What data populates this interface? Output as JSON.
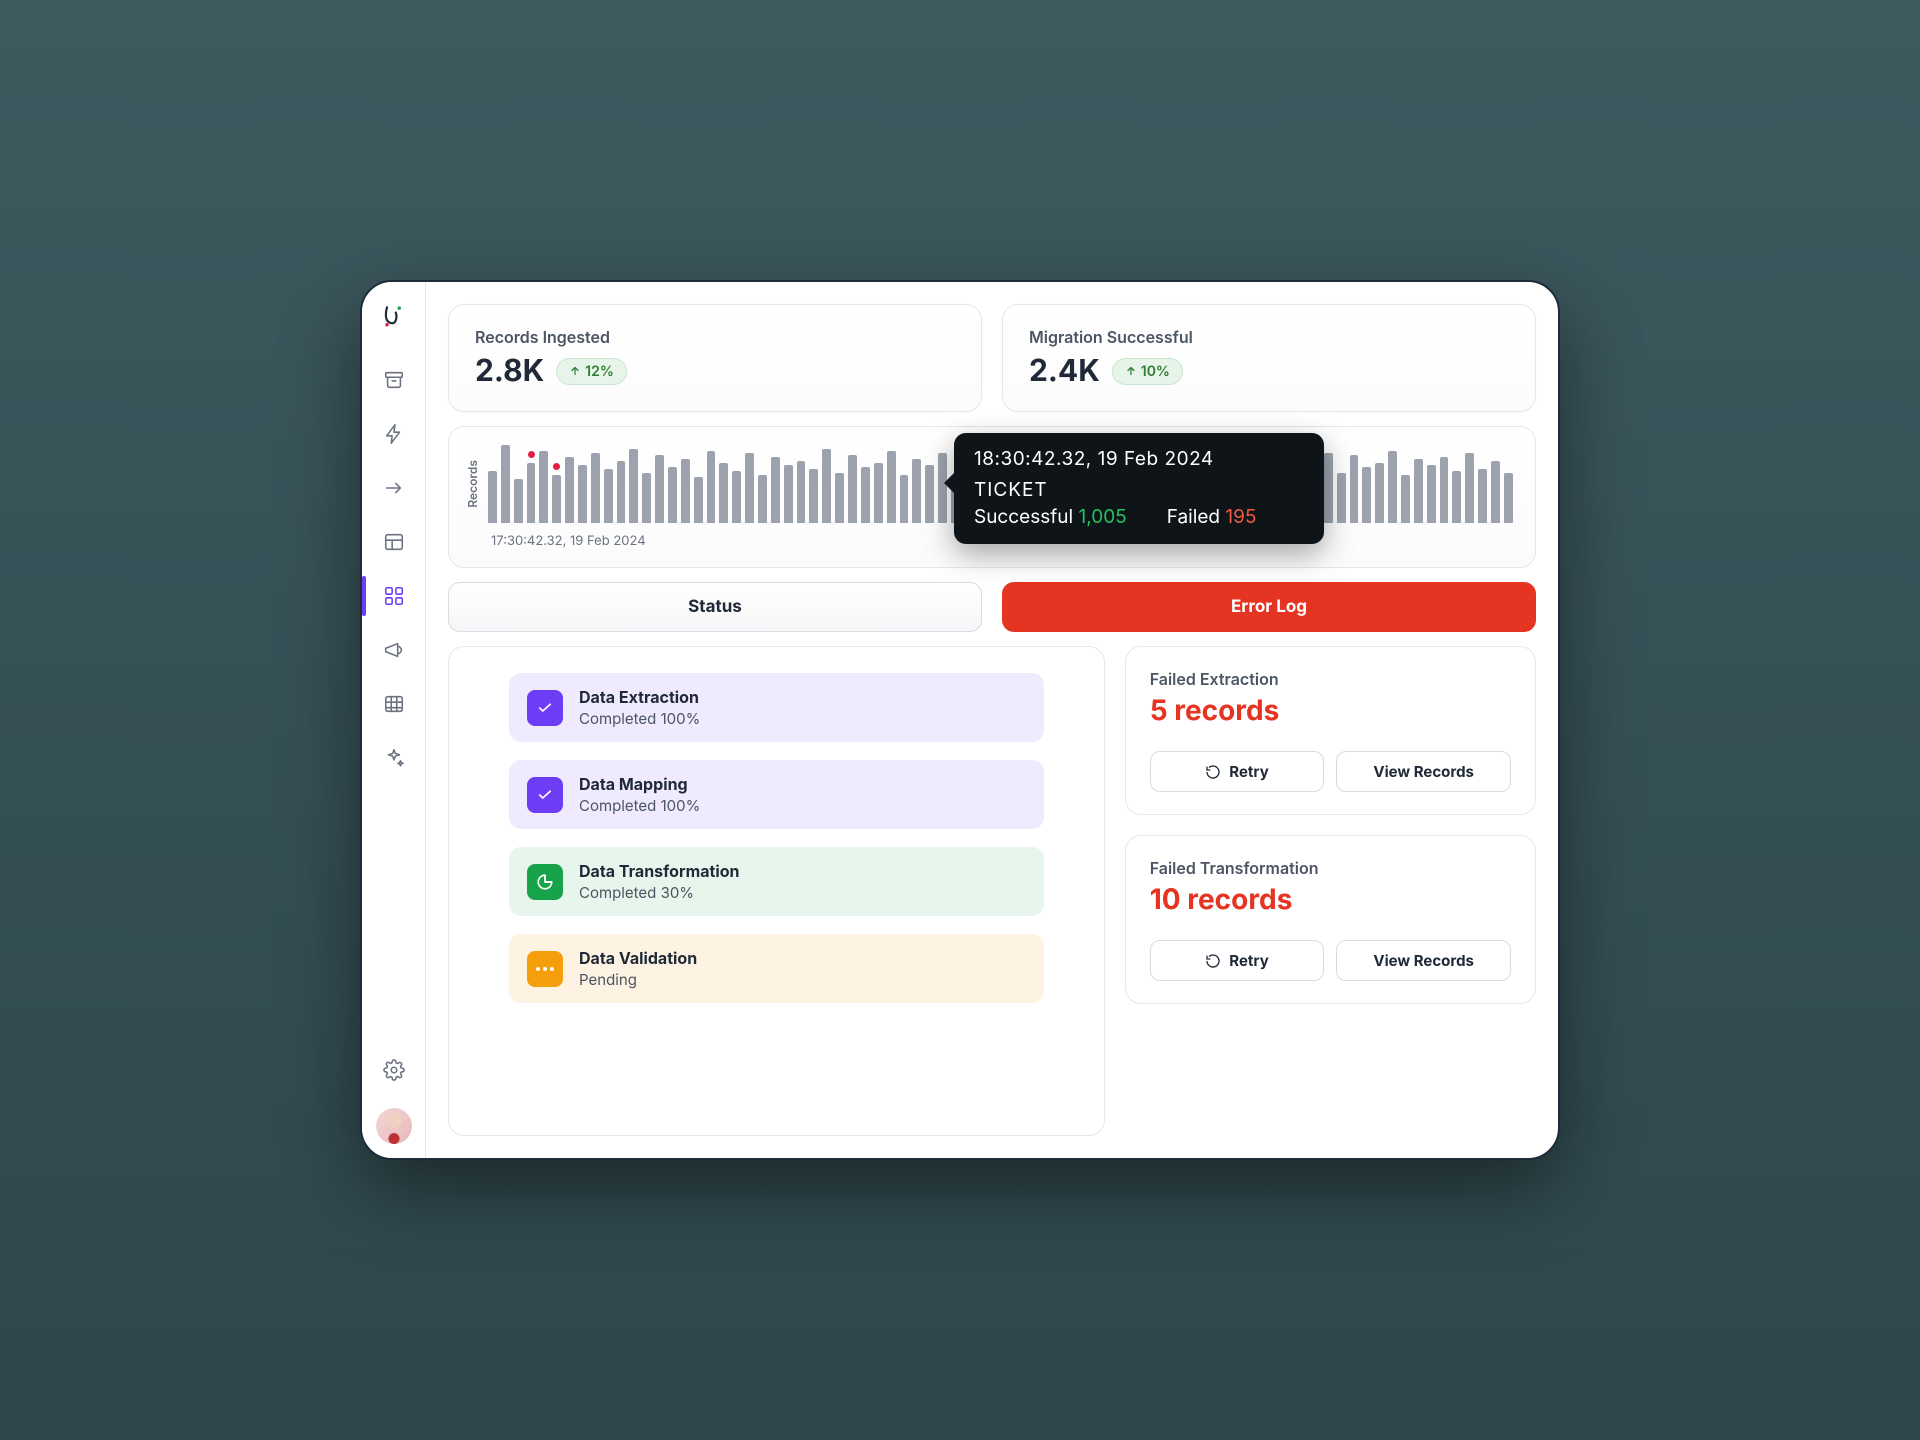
{
  "sidebar": {
    "items": [
      {
        "name": "archive"
      },
      {
        "name": "bolt"
      },
      {
        "name": "arrow-right"
      },
      {
        "name": "layout"
      },
      {
        "name": "dashboard",
        "active": true
      },
      {
        "name": "megaphone"
      },
      {
        "name": "table"
      },
      {
        "name": "sparkles"
      }
    ],
    "settings_name": "settings"
  },
  "stats": {
    "ingested": {
      "title": "Records Ingested",
      "value": "2.8K",
      "trend": "12%"
    },
    "migrated": {
      "title": "Migration Successful",
      "value": "2.4K",
      "trend": "10%"
    }
  },
  "chart_data": {
    "type": "bar",
    "ylabel": "Records",
    "caption": "17:30:42.32, 19 Feb 2024",
    "values": [
      52,
      78,
      44,
      60,
      72,
      48,
      66,
      58,
      70,
      54,
      62,
      74,
      50,
      68,
      56,
      64,
      46,
      72,
      60,
      52,
      70,
      48,
      66,
      58,
      62,
      54,
      74,
      50,
      68,
      56,
      60,
      72,
      48,
      64,
      58,
      70,
      46,
      62,
      54,
      76,
      50,
      68,
      56,
      60,
      72,
      48,
      66,
      58,
      64,
      52,
      70,
      54,
      62,
      74,
      50,
      68,
      56,
      60,
      48,
      72,
      46,
      66,
      58,
      62,
      54,
      70,
      50,
      68,
      56,
      60,
      72,
      48,
      64,
      58,
      66,
      52,
      70,
      54,
      62,
      50
    ],
    "highlight_indices": [
      3,
      5,
      37
    ],
    "tooltip": {
      "time": "18:30:42.32, 19 Feb 2024",
      "label": "TICKET",
      "successful_label": "Successful",
      "successful_value": "1,005",
      "failed_label": "Failed",
      "failed_value": "195"
    }
  },
  "tabs": {
    "status": "Status",
    "error": "Error Log"
  },
  "status": [
    {
      "title": "Data Extraction",
      "sub": "Completed 100%",
      "variant": "purple",
      "icon": "check"
    },
    {
      "title": "Data Mapping",
      "sub": "Completed 100%",
      "variant": "purple",
      "icon": "check"
    },
    {
      "title": "Data Transformation",
      "sub": "Completed 30%",
      "variant": "green",
      "icon": "pie"
    },
    {
      "title": "Data Validation",
      "sub": "Pending",
      "variant": "orange",
      "icon": "dots"
    }
  ],
  "errors": [
    {
      "title": "Failed Extraction",
      "value": "5 records",
      "retry": "Retry",
      "view": "View Records"
    },
    {
      "title": "Failed Transformation",
      "value": "10 records",
      "retry": "Retry",
      "view": "View Records"
    }
  ]
}
